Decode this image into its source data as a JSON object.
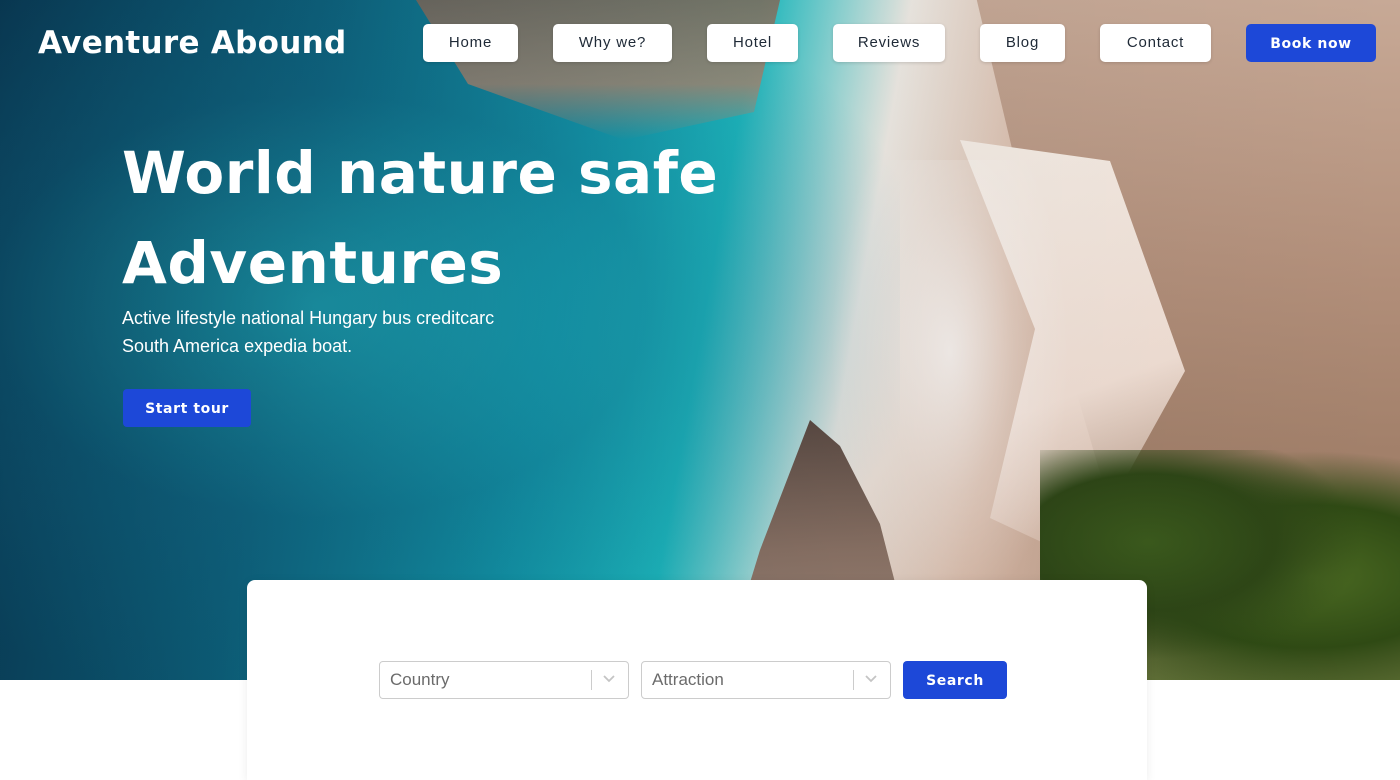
{
  "header": {
    "logo": "Aventure Abound",
    "nav": [
      {
        "label": "Home"
      },
      {
        "label": "Why we?"
      },
      {
        "label": "Hotel"
      },
      {
        "label": "Reviews"
      },
      {
        "label": "Blog"
      },
      {
        "label": "Contact"
      }
    ],
    "book_label": "Book now"
  },
  "hero": {
    "headline_line1": "World nature safe",
    "headline_line2": "Adventures",
    "subtitle": "Active lifestyle national Hungary bus creditcarc South America expedia boat.",
    "cta_label": "Start tour"
  },
  "search": {
    "country_placeholder": "Country",
    "attraction_placeholder": "Attraction",
    "chevron_icon": "chevron-down-icon",
    "button_label": "Search"
  },
  "colors": {
    "accent": "#1d48d8",
    "nav_bg": "#ffffff",
    "text_dark": "#1f2a37"
  }
}
